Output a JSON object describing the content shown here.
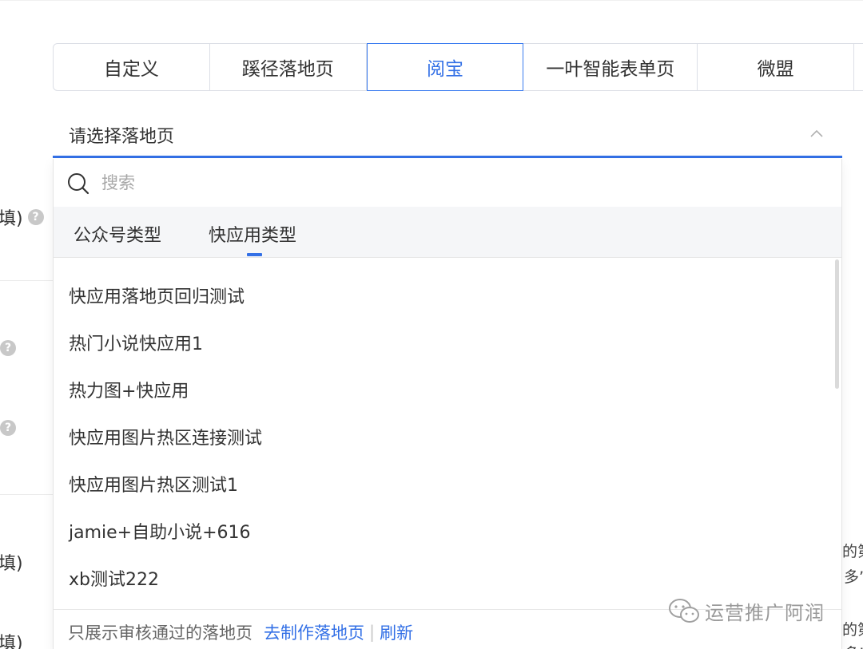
{
  "tabs": [
    {
      "label": "自定义",
      "width": 196
    },
    {
      "label": "蹊径落地页",
      "width": 196
    },
    {
      "label": "阅宝",
      "width": 196,
      "active": true
    },
    {
      "label": "一叶智能表单页",
      "width": 218
    },
    {
      "label": "微盟",
      "width": 196
    }
  ],
  "side_labels": {
    "label_1": "选填)",
    "label_2": "选填)",
    "label_3": "选填)"
  },
  "select": {
    "placeholder": "请选择落地页"
  },
  "dropdown": {
    "search_placeholder": "搜索",
    "type_tabs": [
      "公众号类型",
      "快应用类型"
    ],
    "active_type": "快应用类型",
    "items": [
      "快应用落地页回归测试",
      "热门小说快应用1",
      "热力图+快应用",
      "快应用图片热区连接测试",
      "快应用图片热区测试1",
      "jamie+自助小说+616",
      "xb测试222"
    ],
    "footer": {
      "note": "只展示审核通过的落地页",
      "create_link": "去制作落地页",
      "divider": "|",
      "refresh_link": "刷新"
    }
  },
  "right_fragments": {
    "frag_1": "的第",
    "frag_2": "多”",
    "frag_3": "的第",
    "frag_4": "多”"
  },
  "watermark": {
    "text": "运营推广阿润"
  },
  "colors": {
    "accent": "#3370e6",
    "border": "#dcdfe6",
    "text": "#333333",
    "muted": "#a8a8a8"
  }
}
